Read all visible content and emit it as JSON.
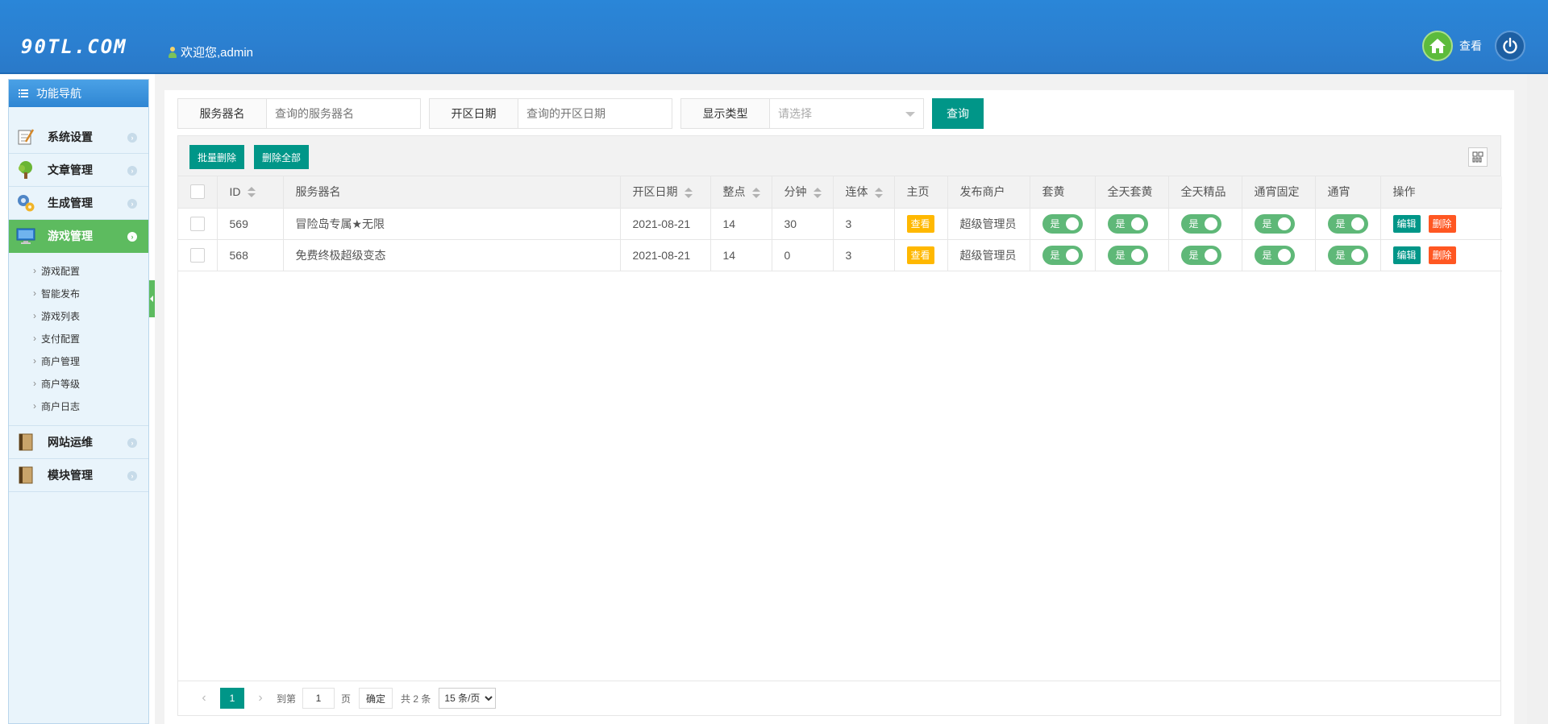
{
  "header": {
    "logo": "90TL.COM",
    "welcome": "欢迎您,admin",
    "view_label": "查看"
  },
  "sidebar": {
    "title": "功能导航",
    "items": [
      {
        "label": "系统设置",
        "icon": "notepad-icon"
      },
      {
        "label": "文章管理",
        "icon": "tree-icon"
      },
      {
        "label": "生成管理",
        "icon": "gears-icon"
      },
      {
        "label": "游戏管理",
        "icon": "monitor-icon",
        "active": true
      }
    ],
    "subitems": [
      "游戏配置",
      "智能发布",
      "游戏列表",
      "支付配置",
      "商户管理",
      "商户等级",
      "商户日志"
    ],
    "items_after": [
      {
        "label": "网站运维",
        "icon": "book-icon"
      },
      {
        "label": "模块管理",
        "icon": "book-icon"
      }
    ]
  },
  "search": {
    "server_label": "服务器名",
    "server_placeholder": "查询的服务器名",
    "date_label": "开区日期",
    "date_placeholder": "查询的开区日期",
    "type_label": "显示类型",
    "type_placeholder": "请选择",
    "query_button": "查询"
  },
  "toolbar": {
    "batch_delete": "批量删除",
    "delete_all": "删除全部"
  },
  "table": {
    "columns": [
      "ID",
      "服务器名",
      "开区日期",
      "整点",
      "分钟",
      "连体",
      "主页",
      "发布商户",
      "套黄",
      "全天套黄",
      "全天精品",
      "通宵固定",
      "通宵",
      "操作"
    ],
    "rows": [
      {
        "id": "569",
        "name": "冒险岛专属★无限",
        "date": "2021-08-21",
        "hour": "14",
        "minute": "30",
        "lianti": "3",
        "home": "查看",
        "merchant": "超级管理员",
        "switch_label": "是",
        "edit": "编辑",
        "delete": "删除"
      },
      {
        "id": "568",
        "name": "免费终极超级变态",
        "date": "2021-08-21",
        "hour": "14",
        "minute": "0",
        "lianti": "3",
        "home": "查看",
        "merchant": "超级管理员",
        "switch_label": "是",
        "edit": "编辑",
        "delete": "删除"
      }
    ]
  },
  "pager": {
    "current": "1",
    "goto_label": "到第",
    "page_value": "1",
    "page_unit": "页",
    "confirm": "确定",
    "total": "共 2 条",
    "size_option": "15 条/页"
  },
  "colors": {
    "header_blue": "#2b7fd0",
    "primary_green": "#009688",
    "active_menu": "#5dbb5f",
    "toggle_on": "#5fb878",
    "view_badge": "#ffb800",
    "delete_red": "#ff5722"
  }
}
